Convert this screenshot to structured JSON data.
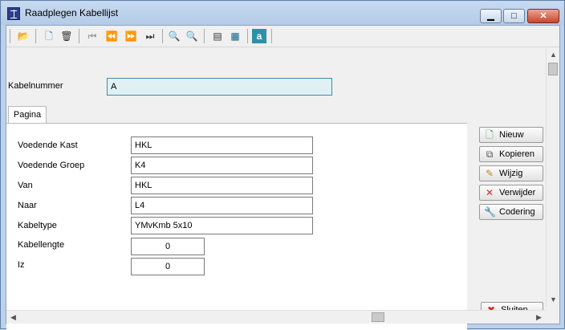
{
  "window": {
    "title": "Raadplegen Kabellijst",
    "minimize_label": "▁",
    "maximize_label": "□",
    "close_label": "✕"
  },
  "toolbar": {
    "open": "📂",
    "new": "🗋",
    "delete": "🗑",
    "first": "⏮",
    "prev": "⏪",
    "next": "⏩",
    "last": "⏭",
    "zoom_in": "🔍",
    "zoom_out": "🔍",
    "print": "▤",
    "table": "▦",
    "format": "a"
  },
  "header": {
    "kabelnummer_label": "Kabelnummer",
    "kabelnummer_value": "A"
  },
  "tabs": [
    {
      "label": "Pagina"
    }
  ],
  "form": {
    "voedende_kast_label": "Voedende Kast",
    "voedende_kast_value": "HKL",
    "voedende_groep_label": "Voedende Groep",
    "voedende_groep_value": "K4",
    "van_label": "Van",
    "van_value": "HKL",
    "naar_label": "Naar",
    "naar_value": "L4",
    "kabeltype_label": "Kabeltype",
    "kabeltype_value": "YMvKmb 5x10",
    "kabellengte_label": "Kabellengte",
    "kabellengte_value": "0",
    "iz_label": "Iz",
    "iz_value": "0"
  },
  "buttons": {
    "nieuw": "Nieuw",
    "kopieren": "Kopieren",
    "wijzig": "Wijzig",
    "verwijder": "Verwijder",
    "codering": "Codering",
    "sluiten": "Sluiten"
  }
}
